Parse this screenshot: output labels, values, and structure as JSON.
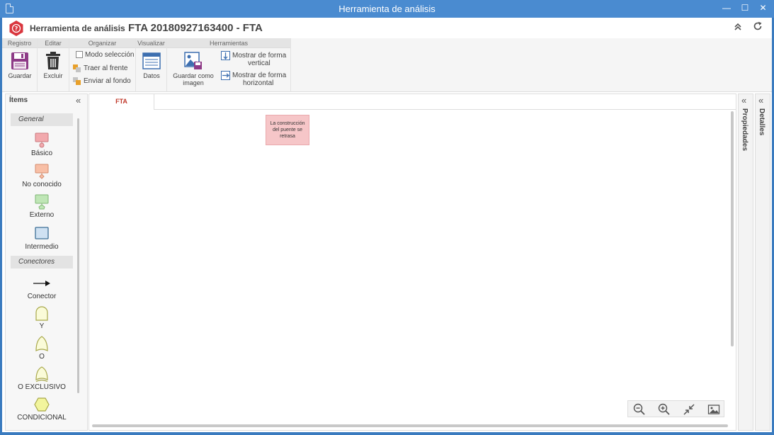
{
  "window": {
    "title": "Herramienta de análisis"
  },
  "header": {
    "crumb_app": "Herramienta de análisis",
    "separator": "›",
    "crumb_doc": "FTA 20180927163400 - FTA"
  },
  "ribbon": {
    "groups": {
      "registro": "Registro",
      "editar": "Editar",
      "organizar": "Organizar",
      "visualizar": "Visualizar",
      "herramientas": "Herramientas"
    },
    "buttons": {
      "guardar": "Guardar",
      "excluir": "Excluir",
      "modo_seleccion": "Modo selección",
      "traer_al_frente": "Traer al frente",
      "enviar_al_fondo": "Enviar al fondo",
      "datos": "Datos",
      "guardar_imagen_1": "Guardar como",
      "guardar_imagen_2": "imagen",
      "vertical_1": "Mostrar de forma",
      "vertical_2": "vertical",
      "horizontal_1": "Mostrar de forma",
      "horizontal_2": "horizontal"
    }
  },
  "items_panel": {
    "title": "Ítems",
    "categories": {
      "general": "General",
      "conectores": "Conectores"
    },
    "general_items": [
      "Básico",
      "No conocido",
      "Externo",
      "Intermedio"
    ],
    "connector_items": [
      "Conector",
      "Y",
      "O",
      "O EXCLUSIVO",
      "CONDICIONAL"
    ]
  },
  "canvas": {
    "tab": "FTA",
    "node_text": "La construcción del puente se retrasa"
  },
  "side_panels": {
    "properties": "Propiedades",
    "details": "Detalles"
  },
  "colors": {
    "titlebar": "#4a8bd0",
    "logo": "#d9363e",
    "tab_text": "#c0392b",
    "node_fill": "#f6c6c8",
    "basic": "#f2a9ad",
    "unknown": "#f8bfa6",
    "external": "#bfe6b6",
    "intermediate": "#cfe1f2",
    "gate": "#fafbd8",
    "conditional": "#f2f59d"
  }
}
